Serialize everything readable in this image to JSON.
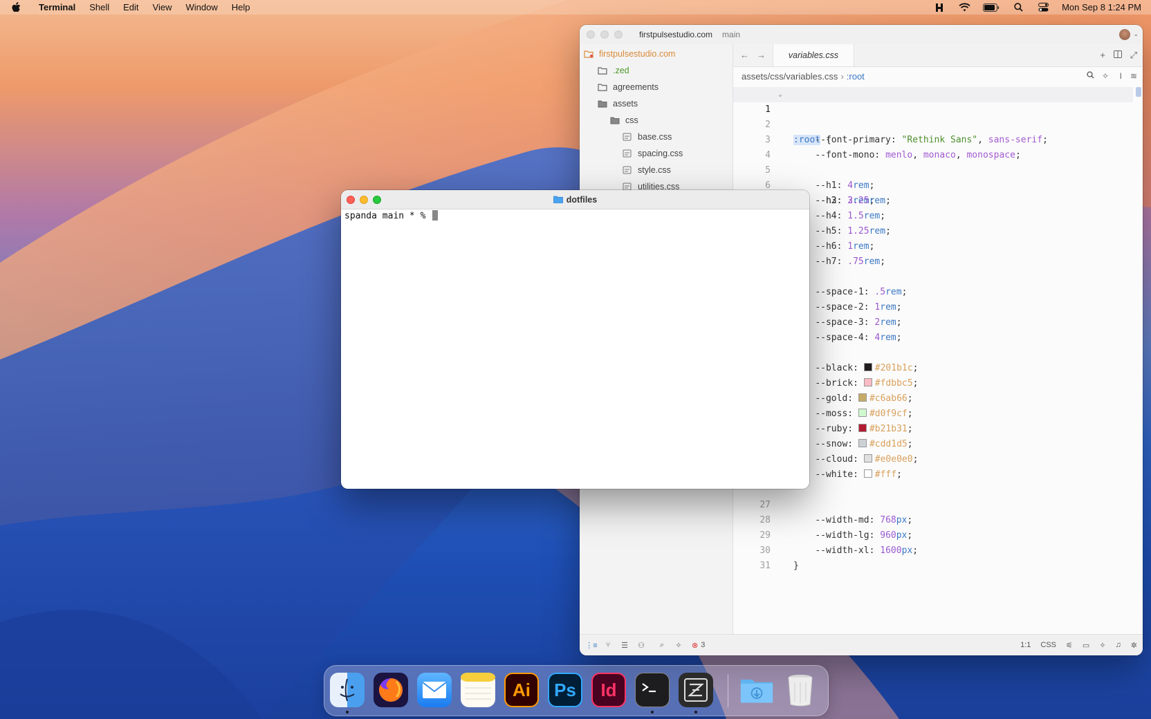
{
  "menubar": {
    "app_name": "Terminal",
    "items": [
      "Shell",
      "Edit",
      "View",
      "Window",
      "Help"
    ],
    "clock": "Mon Sep 8  1:24 PM"
  },
  "zed": {
    "project": "firstpulsestudio.com",
    "branch": "main",
    "tree": [
      {
        "label": "firstpulsestudio.com",
        "kind": "root"
      },
      {
        "label": ".zed",
        "kind": "folder-zed"
      },
      {
        "label": "agreements",
        "kind": "folder"
      },
      {
        "label": "assets",
        "kind": "folder-open"
      },
      {
        "label": "css",
        "kind": "folder-open"
      },
      {
        "label": "base.css",
        "kind": "file"
      },
      {
        "label": "spacing.css",
        "kind": "file"
      },
      {
        "label": "style.css",
        "kind": "file"
      },
      {
        "label": "utilities.css",
        "kind": "file"
      }
    ],
    "tab": "variables.css",
    "breadcrumb_path": "assets/css/variables.css",
    "breadcrumb_sep": "›",
    "breadcrumb_symbol": ":root",
    "code_lines": [
      {
        "n": "1"
      },
      {
        "n": "2"
      },
      {
        "n": "3"
      },
      {
        "n": "4"
      },
      {
        "n": "5"
      },
      {
        "n": "6"
      },
      {
        "n": "27"
      },
      {
        "n": "28"
      },
      {
        "n": "29"
      },
      {
        "n": "30"
      },
      {
        "n": "31"
      }
    ],
    "code": {
      "l1_root": ":root",
      "l1_brace": " {",
      "font_primary": "--font-primary",
      "rethink": "\"Rethink Sans\"",
      "sans_serif": "sans-serif",
      "font_mono": "--font-mono",
      "menlo": "menlo",
      "monaco": "monaco",
      "monospace": "monospace",
      "h1": "--h1",
      "h1v": "4",
      "h2": "--h2",
      "h2v": "3",
      "h3": "--h3",
      "h3v": "2.25",
      "h4": "--h4",
      "h4v": "1.5",
      "h5": "--h5",
      "h5v": "1.25",
      "h6": "--h6",
      "h6v": "1",
      "h7": "--h7",
      "h7v": ".75",
      "rem": "rem",
      "px": "px",
      "s1": "--space-1",
      "s1v": ".5",
      "s2": "--space-2",
      "s2v": "1",
      "s3": "--space-3",
      "s3v": "2",
      "s4": "--space-4",
      "s4v": "4",
      "black": "--black",
      "black_hex": "#201b1c",
      "brick": "--brick",
      "brick_hex": "#fdbbc5",
      "gold": "--gold",
      "gold_hex": "#c6ab66",
      "moss": "--moss",
      "moss_hex": "#d0f9cf",
      "ruby": "--ruby",
      "ruby_hex": "#b21b31",
      "snow": "--snow",
      "snow_hex": "#cdd1d5",
      "cloud": "--cloud",
      "cloud_hex": "#e0e0e0",
      "white": "--white",
      "white_hex": "#fff",
      "wmd": "--width-md",
      "wmdv": "768",
      "wlg": "--width-lg",
      "wlgv": "960",
      "wxl": "--width-xl",
      "wxlv": "1600",
      "close_brace": "}"
    },
    "status": {
      "errors": "3",
      "cursor": "1:1",
      "language": "CSS"
    }
  },
  "terminal": {
    "title": "dotfiles",
    "prompt": "spanda main * % "
  },
  "dock": {
    "apps": [
      "Finder",
      "Firefox",
      "Mail",
      "Notes",
      "Illustrator",
      "Photoshop",
      "InDesign",
      "Terminal",
      "Zed",
      "Downloads",
      "Trash"
    ],
    "labels": {
      "ai": "Ai",
      "ps": "Ps",
      "id": "Id"
    }
  }
}
